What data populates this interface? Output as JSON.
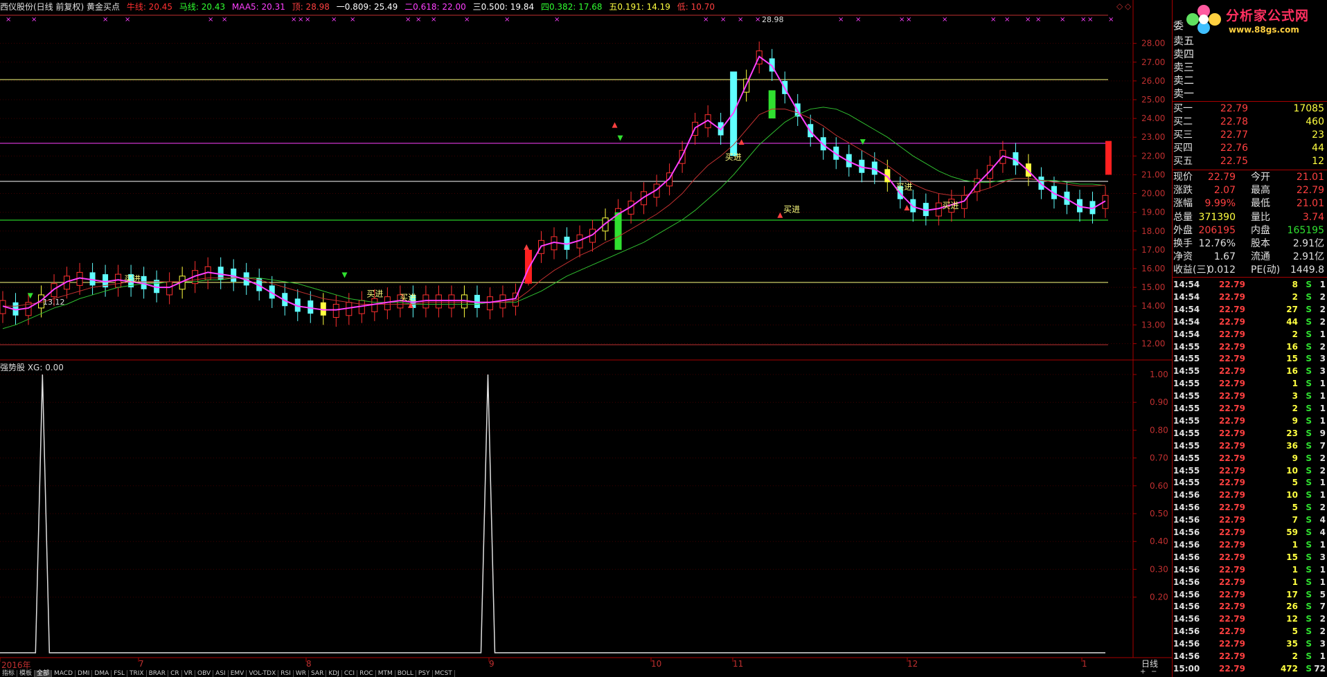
{
  "title": "西仪股份(日线 前复权) 黄金买点",
  "legend": [
    {
      "label": "牛线: 20.45",
      "color": "#ff3030"
    },
    {
      "label": "马线: 20.43",
      "color": "#30ff30"
    },
    {
      "label": "MAA5: 20.31",
      "color": "#ff40ff"
    },
    {
      "label": "顶: 28.98",
      "color": "#ff4040"
    },
    {
      "label": "一0.809: 25.49",
      "color": "#ffffff"
    },
    {
      "label": "二0.618: 22.00",
      "color": "#ff40ff"
    },
    {
      "label": "三0.500: 19.84",
      "color": "#ffffff"
    },
    {
      "label": "四0.382: 17.68",
      "color": "#30ff30"
    },
    {
      "label": "五0.191: 14.19",
      "color": "#ffff40"
    },
    {
      "label": "低: 10.70",
      "color": "#ff4040"
    }
  ],
  "controls": {
    "diamond": "◇",
    "square": "◇"
  },
  "price_axis": [
    "28.00",
    "27.00",
    "26.00",
    "25.00",
    "24.00",
    "23.00",
    "22.00",
    "21.00",
    "20.00",
    "19.00",
    "18.00",
    "17.00",
    "16.00",
    "15.00",
    "14.00",
    "13.00",
    "12.00"
  ],
  "annotations": {
    "high": "28.98",
    "low": "13.12",
    "buy": "买进"
  },
  "indicator": {
    "label": "强势股 XG: 0.00",
    "axis": [
      "1.00",
      "0.90",
      "0.80",
      "0.70",
      "0.60",
      "0.50",
      "0.40",
      "0.30",
      "0.20"
    ]
  },
  "x_labels": [
    {
      "label": "2016年"
    },
    {
      "label": "7"
    },
    {
      "label": "8"
    },
    {
      "label": "9"
    },
    {
      "label": "10"
    },
    {
      "label": "11"
    },
    {
      "label": "12"
    },
    {
      "label": "1"
    }
  ],
  "period": "日线",
  "tabs": [
    "指标",
    "模板",
    "全部",
    "MACD",
    "DMI",
    "DMA",
    "FSL",
    "TRIX",
    "BRAR",
    "CR",
    "VR",
    "OBV",
    "ASI",
    "EMV",
    "VOL-TDX",
    "RSI",
    "WR",
    "SAR",
    "KDJ",
    "CCI",
    "ROC",
    "MTM",
    "BOLL",
    "PSY",
    "MCST"
  ],
  "logo": {
    "text": "分析家公式网",
    "url": "www.88gs.com"
  },
  "orderbook": {
    "wei": "委",
    "sell": [
      "卖五",
      "卖四",
      "卖三",
      "卖二",
      "卖一"
    ],
    "buy": [
      {
        "label": "买一",
        "price": "22.79",
        "vol": "17085"
      },
      {
        "label": "买二",
        "price": "22.78",
        "vol": "460"
      },
      {
        "label": "买三",
        "price": "22.77",
        "vol": "23"
      },
      {
        "label": "买四",
        "price": "22.76",
        "vol": "44"
      },
      {
        "label": "买五",
        "price": "22.75",
        "vol": "12"
      }
    ]
  },
  "quote": [
    {
      "l1": "现价",
      "v1": "22.79",
      "c1": "#ff4040",
      "l2": "今开",
      "v2": "21.01",
      "c2": "#ff4040"
    },
    {
      "l1": "涨跌",
      "v1": "2.07",
      "c1": "#ff4040",
      "l2": "最高",
      "v2": "22.79",
      "c2": "#ff4040"
    },
    {
      "l1": "涨幅",
      "v1": "9.99%",
      "c1": "#ff4040",
      "l2": "最低",
      "v2": "21.01",
      "c2": "#ff4040"
    },
    {
      "l1": "总量",
      "v1": "371390",
      "c1": "#ffff40",
      "l2": "量比",
      "v2": "3.74",
      "c2": "#ff4040"
    },
    {
      "l1": "外盘",
      "v1": "206195",
      "c1": "#ff4040",
      "l2": "内盘",
      "v2": "165195",
      "c2": "#30e030"
    },
    {
      "l1": "换手",
      "v1": "12.76%",
      "c1": "#e0e0e0",
      "l2": "股本",
      "v2": "2.91亿",
      "c2": "#e0e0e0"
    },
    {
      "l1": "净资",
      "v1": "1.67",
      "c1": "#e0e0e0",
      "l2": "流通",
      "v2": "2.91亿",
      "c2": "#e0e0e0"
    },
    {
      "l1": "收益(三)",
      "v1": "0.012",
      "c1": "#e0e0e0",
      "l2": "PE(动)",
      "v2": "1449.8",
      "c2": "#e0e0e0"
    }
  ],
  "ticks": [
    {
      "time": "14:54",
      "price": "22.79",
      "vol": "8",
      "bs": "S",
      "n": "1"
    },
    {
      "time": "14:54",
      "price": "22.79",
      "vol": "2",
      "bs": "S",
      "n": "2"
    },
    {
      "time": "14:54",
      "price": "22.79",
      "vol": "27",
      "bs": "S",
      "n": "2"
    },
    {
      "time": "14:54",
      "price": "22.79",
      "vol": "44",
      "bs": "S",
      "n": "2"
    },
    {
      "time": "14:54",
      "price": "22.79",
      "vol": "2",
      "bs": "S",
      "n": "1"
    },
    {
      "time": "14:55",
      "price": "22.79",
      "vol": "16",
      "bs": "S",
      "n": "2"
    },
    {
      "time": "14:55",
      "price": "22.79",
      "vol": "15",
      "bs": "S",
      "n": "3"
    },
    {
      "time": "14:55",
      "price": "22.79",
      "vol": "16",
      "bs": "S",
      "n": "3"
    },
    {
      "time": "14:55",
      "price": "22.79",
      "vol": "1",
      "bs": "S",
      "n": "1"
    },
    {
      "time": "14:55",
      "price": "22.79",
      "vol": "3",
      "bs": "S",
      "n": "1"
    },
    {
      "time": "14:55",
      "price": "22.79",
      "vol": "2",
      "bs": "S",
      "n": "1"
    },
    {
      "time": "14:55",
      "price": "22.79",
      "vol": "9",
      "bs": "S",
      "n": "1"
    },
    {
      "time": "14:55",
      "price": "22.79",
      "vol": "23",
      "bs": "S",
      "n": "9"
    },
    {
      "time": "14:55",
      "price": "22.79",
      "vol": "36",
      "bs": "S",
      "n": "7"
    },
    {
      "time": "14:55",
      "price": "22.79",
      "vol": "9",
      "bs": "S",
      "n": "2"
    },
    {
      "time": "14:55",
      "price": "22.79",
      "vol": "10",
      "bs": "S",
      "n": "2"
    },
    {
      "time": "14:55",
      "price": "22.79",
      "vol": "5",
      "bs": "S",
      "n": "1"
    },
    {
      "time": "14:56",
      "price": "22.79",
      "vol": "10",
      "bs": "S",
      "n": "1"
    },
    {
      "time": "14:56",
      "price": "22.79",
      "vol": "5",
      "bs": "S",
      "n": "2"
    },
    {
      "time": "14:56",
      "price": "22.79",
      "vol": "7",
      "bs": "S",
      "n": "4"
    },
    {
      "time": "14:56",
      "price": "22.79",
      "vol": "59",
      "bs": "S",
      "n": "4"
    },
    {
      "time": "14:56",
      "price": "22.79",
      "vol": "1",
      "bs": "S",
      "n": "1"
    },
    {
      "time": "14:56",
      "price": "22.79",
      "vol": "15",
      "bs": "S",
      "n": "3"
    },
    {
      "time": "14:56",
      "price": "22.79",
      "vol": "1",
      "bs": "S",
      "n": "1"
    },
    {
      "time": "14:56",
      "price": "22.79",
      "vol": "1",
      "bs": "S",
      "n": "1"
    },
    {
      "time": "14:56",
      "price": "22.79",
      "vol": "17",
      "bs": "S",
      "n": "5"
    },
    {
      "time": "14:56",
      "price": "22.79",
      "vol": "26",
      "bs": "S",
      "n": "7"
    },
    {
      "time": "14:56",
      "price": "22.79",
      "vol": "12",
      "bs": "S",
      "n": "2"
    },
    {
      "time": "14:56",
      "price": "22.79",
      "vol": "5",
      "bs": "S",
      "n": "2"
    },
    {
      "time": "14:56",
      "price": "22.79",
      "vol": "35",
      "bs": "S",
      "n": "3"
    },
    {
      "time": "14:56",
      "price": "22.79",
      "vol": "2",
      "bs": "S",
      "n": "1"
    },
    {
      "time": "15:00",
      "price": "22.79",
      "vol": "472",
      "bs": "S",
      "n": "72"
    }
  ],
  "chart_data": {
    "type": "line",
    "title": "西仪股份(日线 前复权) 黄金买点",
    "ylim": [
      11.5,
      29.5
    ],
    "levels": [
      28.98,
      25.49,
      22.0,
      19.84,
      17.68,
      14.19,
      10.7
    ],
    "x_labels": [
      "2016年",
      "7",
      "8",
      "9",
      "10",
      "11",
      "12",
      "1"
    ],
    "maa5": [
      14.0,
      13.8,
      13.9,
      14.3,
      14.9,
      15.3,
      15.5,
      15.4,
      15.3,
      15.4,
      15.3,
      15.2,
      15.0,
      15.0,
      15.3,
      15.6,
      15.8,
      15.7,
      15.6,
      15.4,
      15.1,
      14.7,
      14.3,
      14.0,
      13.9,
      13.8,
      13.8,
      13.9,
      14.0,
      14.1,
      14.2,
      14.3,
      14.2,
      14.3,
      14.3,
      14.3,
      14.3,
      14.2,
      14.2,
      14.3,
      14.4,
      16.0,
      17.2,
      17.4,
      17.3,
      17.5,
      17.8,
      18.4,
      18.9,
      19.3,
      19.8,
      20.2,
      20.8,
      22.0,
      23.5,
      23.9,
      23.4,
      24.3,
      25.8,
      27.3,
      26.8,
      25.6,
      24.4,
      23.3,
      22.6,
      22.1,
      21.7,
      21.4,
      21.3,
      20.9,
      20.0,
      19.3,
      19.1,
      19.2,
      19.4,
      19.6,
      20.5,
      21.2,
      22.0,
      21.8,
      21.2,
      20.5,
      20.0,
      19.7,
      19.3,
      19.2,
      19.6
    ],
    "ma_red": [
      14.0,
      14.0,
      14.1,
      14.2,
      14.4,
      14.6,
      14.8,
      15.0,
      15.1,
      15.2,
      15.3,
      15.3,
      15.3,
      15.3,
      15.3,
      15.4,
      15.5,
      15.5,
      15.5,
      15.5,
      15.4,
      15.2,
      15.0,
      14.8,
      14.6,
      14.4,
      14.3,
      14.2,
      14.1,
      14.1,
      14.1,
      14.1,
      14.1,
      14.2,
      14.2,
      14.2,
      14.2,
      14.2,
      14.2,
      14.2,
      14.3,
      14.8,
      15.4,
      15.9,
      16.3,
      16.7,
      17.0,
      17.4,
      17.7,
      18.1,
      18.5,
      18.9,
      19.4,
      20.0,
      20.8,
      21.5,
      22.0,
      22.6,
      23.4,
      24.2,
      24.5,
      24.5,
      24.3,
      24.0,
      23.6,
      23.1,
      22.7,
      22.3,
      21.9,
      21.5,
      21.0,
      20.5,
      20.2,
      20.0,
      19.9,
      19.9,
      20.1,
      20.3,
      20.6,
      20.8,
      20.8,
      20.7,
      20.6,
      20.5,
      20.4,
      20.4,
      20.45
    ],
    "ma_green": [
      12.8,
      13.0,
      13.3,
      13.6,
      13.9,
      14.1,
      14.4,
      14.6,
      14.8,
      15.0,
      15.1,
      15.2,
      15.2,
      15.3,
      15.3,
      15.3,
      15.4,
      15.4,
      15.5,
      15.5,
      15.5,
      15.4,
      15.3,
      15.2,
      15.0,
      14.8,
      14.6,
      14.4,
      14.3,
      14.2,
      14.2,
      14.2,
      14.1,
      14.1,
      14.1,
      14.1,
      14.1,
      14.1,
      14.2,
      14.2,
      14.2,
      14.5,
      14.8,
      15.2,
      15.6,
      15.9,
      16.2,
      16.5,
      16.8,
      17.1,
      17.4,
      17.8,
      18.2,
      18.6,
      19.1,
      19.7,
      20.3,
      21.0,
      21.8,
      22.6,
      23.2,
      23.8,
      24.2,
      24.5,
      24.6,
      24.5,
      24.2,
      23.8,
      23.4,
      23.0,
      22.5,
      22.0,
      21.6,
      21.2,
      20.9,
      20.7,
      20.6,
      20.6,
      20.7,
      20.8,
      20.8,
      20.7,
      20.7,
      20.6,
      20.5,
      20.5,
      20.43
    ],
    "xg_signal_positions": [
      0.036,
      0.44
    ]
  }
}
